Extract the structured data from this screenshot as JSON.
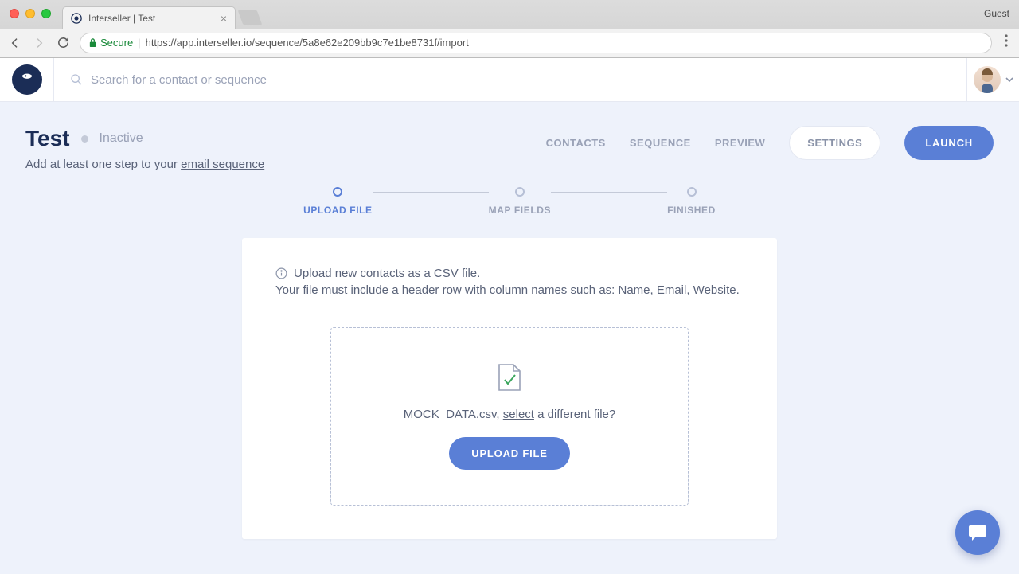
{
  "browser": {
    "tab_title": "Interseller | Test",
    "guest_label": "Guest",
    "secure_label": "Secure",
    "url": "https://app.interseller.io/sequence/5a8e62e209bb9c7e1be8731f/import"
  },
  "header": {
    "search_placeholder": "Search for a contact or sequence"
  },
  "sequence": {
    "title": "Test",
    "status": "Inactive",
    "subtext_prefix": "Add at least one step to your ",
    "subtext_link": "email sequence",
    "nav": {
      "contacts": "CONTACTS",
      "sequence": "SEQUENCE",
      "preview": "PREVIEW",
      "settings": "SETTINGS",
      "launch": "LAUNCH"
    }
  },
  "stepper": {
    "upload": "UPLOAD FILE",
    "map": "MAP FIELDS",
    "finished": "FINISHED"
  },
  "card": {
    "info_line1": "Upload new contacts as a CSV file.",
    "info_line2": "Your file must include a header row with column names such as: Name, Email, Website.",
    "file_name": "MOCK_DATA.csv, ",
    "select_link": "select",
    "file_suffix": " a different file?",
    "upload_button": "UPLOAD FILE"
  }
}
